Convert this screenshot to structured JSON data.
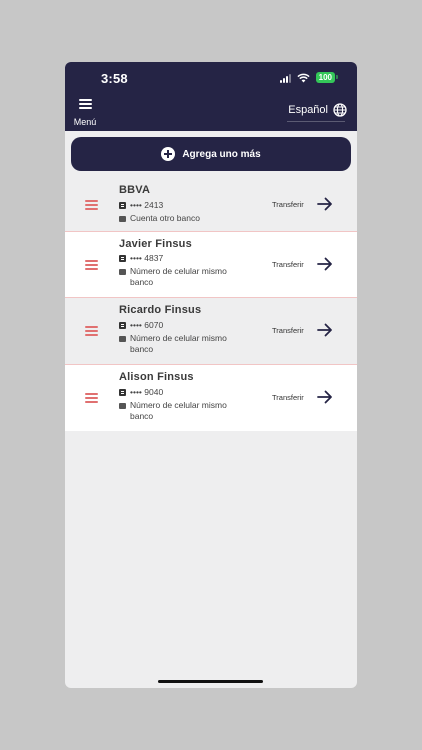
{
  "status_bar": {
    "time": "3:58",
    "battery": "100"
  },
  "header": {
    "menu_label": "Menú",
    "language": "Español"
  },
  "add_button": {
    "label": "Agrega uno más"
  },
  "contacts": [
    {
      "name": "BBVA",
      "account": "•••• 2413",
      "type": "Cuenta otro banco",
      "action": "Transferir"
    },
    {
      "name": "Javier Finsus",
      "account": "•••• 4837",
      "type": "Número de celular mismo banco",
      "action": "Transferir"
    },
    {
      "name": "Ricardo Finsus",
      "account": "•••• 6070",
      "type": "Número de celular mismo banco",
      "action": "Transferir"
    },
    {
      "name": "Alison Finsus",
      "account": "•••• 9040",
      "type": "Número de celular mismo banco",
      "action": "Transferir"
    }
  ],
  "colors": {
    "primary": "#252445",
    "drag_handle": "#e07070",
    "battery": "#34c759"
  }
}
